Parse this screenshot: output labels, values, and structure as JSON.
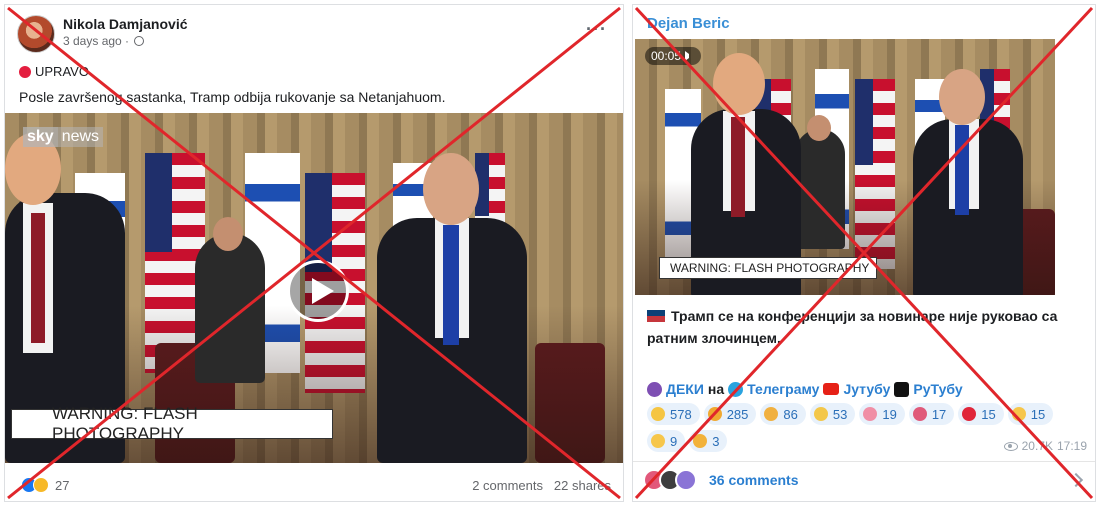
{
  "facebook_post": {
    "author": "Nikola Damjanović",
    "time": "3 days ago · ",
    "live_label": "UPRAVO",
    "text": "Posle završenog sastanka, Tramp odbija rukovanje sa Netanjahuom.",
    "video": {
      "logo_part1": "sky",
      "logo_part2": "news",
      "warning": "WARNING: FLASH PHOTOGRAPHY"
    },
    "reactions_count": "27",
    "comments": "2 comments",
    "shares": "22 shares"
  },
  "telegram_post": {
    "channel": "Dejan Beric",
    "video": {
      "timer": "00:05",
      "warning": "WARNING: FLASH PHOTOGRAPHY"
    },
    "text": "Трамп се на конференцији за новинаре није руковао са ратним злочинцем.",
    "links": {
      "deki": "ДЕКИ",
      "on": "на",
      "telegram": "Телеграму",
      "youtube": "Јутубу",
      "rutube": "РуТубу"
    },
    "reactions": [
      {
        "count": "578",
        "color": "#f5c542"
      },
      {
        "count": "285",
        "color": "#f0a830"
      },
      {
        "count": "86",
        "color": "#f0b040"
      },
      {
        "count": "53",
        "color": "#f3c74a"
      },
      {
        "count": "19",
        "color": "#f08fa6"
      },
      {
        "count": "17",
        "color": "#e05a7a"
      },
      {
        "count": "15",
        "color": "#e0263a"
      },
      {
        "count": "15",
        "color": "#f6c64b"
      },
      {
        "count": "9",
        "color": "#f6c64b"
      },
      {
        "count": "3",
        "color": "#f2b23a"
      }
    ],
    "views": "20.7K",
    "time": "17:19",
    "comments": "36 comments"
  },
  "colors": {
    "cross": "#e0262b",
    "link": "#2b7fd0",
    "channel": "#3a8fd6"
  }
}
